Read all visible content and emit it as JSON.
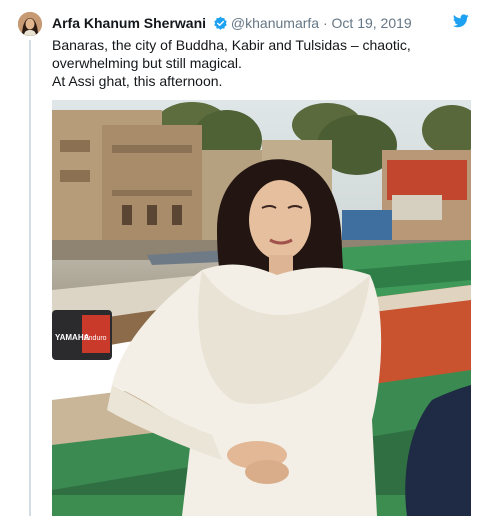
{
  "tweet": {
    "author_name": "Arfa Khanum Sherwani",
    "handle": "@khanumarfa",
    "separator": "·",
    "date": "Oct 19, 2019",
    "text_lines": [
      "Banaras, the city of Buddha, Kabir and Tulsidas  – chaotic,",
      "overwhelming but still magical.",
      "At Assi ghat, this afternoon."
    ],
    "verified": true
  },
  "photo": {
    "boat_motor_brand": "YAMAHA",
    "boat_motor_model": "Enduro"
  },
  "colors": {
    "twitter_blue": "#1da1f2",
    "text": "#14171a",
    "muted": "#657786"
  },
  "icons": {
    "verified": "verified-badge-icon",
    "brand": "twitter-bird-icon"
  }
}
